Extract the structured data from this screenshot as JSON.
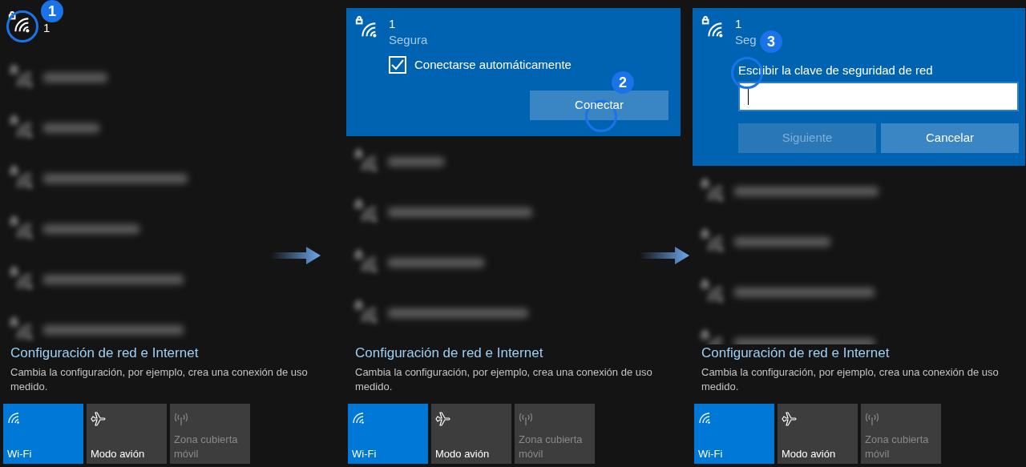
{
  "panels": [
    {
      "kind": "list",
      "step": "1",
      "network": {
        "name": "1"
      },
      "blurred_rows": [
        {
          "kind": "network"
        },
        {
          "kind": "network"
        },
        {
          "kind": "network"
        },
        {
          "kind": "network"
        },
        {
          "kind": "network"
        },
        {
          "kind": "network"
        }
      ],
      "settings_link": "Configuración de red e Internet",
      "settings_description": "Cambia la configuración, por ejemplo, crea una conexión de uso medido.",
      "tiles": [
        {
          "label": "Wi-Fi",
          "kind": "wifi",
          "on": true,
          "disabled": false
        },
        {
          "label": "Modo avión",
          "kind": "airplane",
          "on": false,
          "disabled": false
        },
        {
          "label": "Zona cubierta móvil",
          "kind": "hotspot",
          "on": false,
          "disabled": true
        }
      ]
    },
    {
      "kind": "connect",
      "step": "2",
      "network": {
        "name": "1",
        "status": "Segura"
      },
      "auto_connect": {
        "label": "Conectarse automáticamente",
        "checked": true
      },
      "buttons": [
        {
          "label": "Conectar",
          "disabled": false
        }
      ],
      "blurred_rows": [
        {
          "kind": "network"
        },
        {
          "kind": "network"
        },
        {
          "kind": "network"
        },
        {
          "kind": "network"
        }
      ],
      "settings_link": "Configuración de red e Internet",
      "settings_description": "Cambia la configuración, por ejemplo, crea una conexión de uso medido.",
      "tiles": [
        {
          "label": "Wi-Fi",
          "kind": "wifi",
          "on": true,
          "disabled": false
        },
        {
          "label": "Modo avión",
          "kind": "airplane",
          "on": false,
          "disabled": false
        },
        {
          "label": "Zona cubierta móvil",
          "kind": "hotspot",
          "on": false,
          "disabled": true
        }
      ]
    },
    {
      "kind": "password",
      "step": "3",
      "network": {
        "name": "1",
        "status": "Seg"
      },
      "key_prompt": "Escribir la clave de seguridad de red",
      "buttons": [
        {
          "label": "Siguiente",
          "disabled": true
        },
        {
          "label": "Cancelar",
          "disabled": false
        }
      ],
      "blurred_rows": [
        {
          "kind": "network"
        },
        {
          "kind": "network"
        },
        {
          "kind": "network"
        },
        {
          "kind": "network"
        }
      ],
      "settings_link": "Configuración de red e Internet",
      "settings_description": "Cambia la configuración, por ejemplo, crea una conexión de uso medido.",
      "tiles": [
        {
          "label": "Wi-Fi",
          "kind": "wifi",
          "on": true,
          "disabled": false
        },
        {
          "label": "Modo avión",
          "kind": "airplane",
          "on": false,
          "disabled": false
        },
        {
          "label": "Zona cubierta móvil",
          "kind": "hotspot",
          "on": false,
          "disabled": true
        }
      ]
    }
  ]
}
